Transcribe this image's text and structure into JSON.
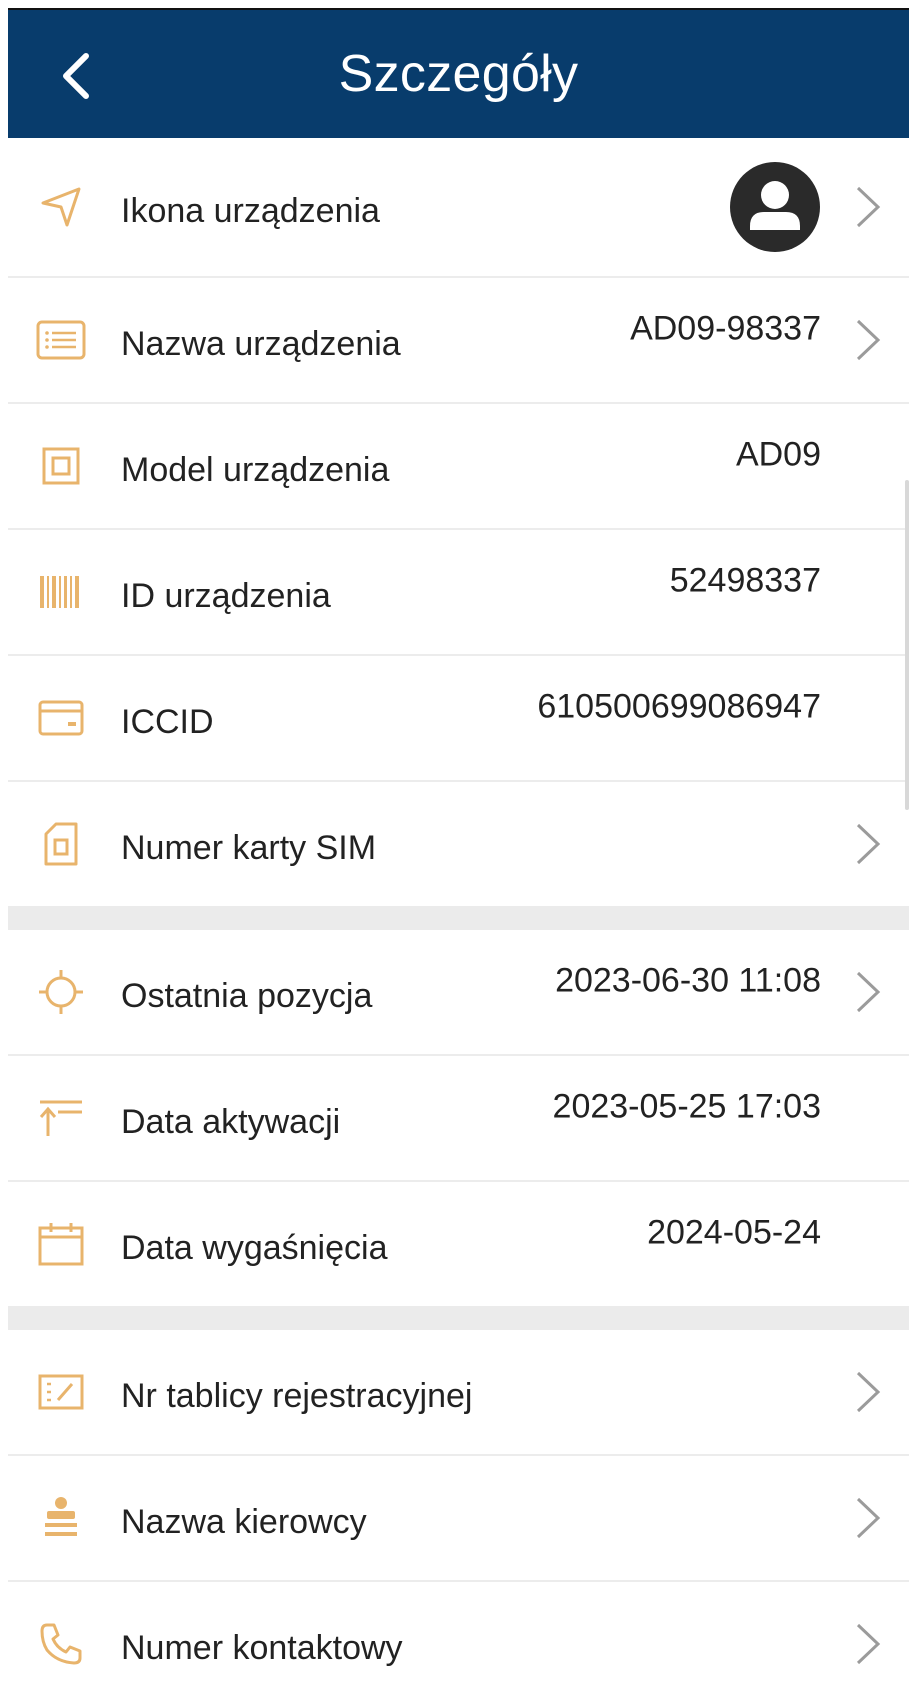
{
  "header": {
    "title": "Szczegóły",
    "background": "#083c6c"
  },
  "accent_color": "#e8b46c",
  "rows": [
    {
      "label": "Ikona urządzenia",
      "value": "",
      "icon": "navigation-arrow-icon",
      "chevron": true,
      "avatar": true
    },
    {
      "label": "Nazwa urządzenia",
      "value": "AD09-98337",
      "icon": "list-icon",
      "chevron": true
    },
    {
      "label": "Model urządzenia",
      "value": "AD09",
      "icon": "model-square-icon",
      "chevron": false
    },
    {
      "label": "ID urządzenia",
      "value": "52498337",
      "icon": "barcode-icon",
      "chevron": false
    },
    {
      "label": "ICCID",
      "value": "610500699086947",
      "icon": "card-icon",
      "chevron": false
    },
    {
      "label": "Numer karty SIM",
      "value": "",
      "icon": "sim-card-icon",
      "chevron": true
    },
    {
      "label": "Ostatnia pozycja",
      "value": "2023-06-30 11:08",
      "icon": "crosshair-icon",
      "chevron": true
    },
    {
      "label": "Data aktywacji",
      "value": "2023-05-25 17:03",
      "icon": "activation-arrow-icon",
      "chevron": false
    },
    {
      "label": "Data wygaśnięcia",
      "value": "2024-05-24",
      "icon": "calendar-icon",
      "chevron": false
    },
    {
      "label": "Nr tablicy rejestracyjnej",
      "value": "",
      "icon": "license-plate-icon",
      "chevron": true
    },
    {
      "label": "Nazwa kierowcy",
      "value": "",
      "icon": "driver-icon",
      "chevron": true
    },
    {
      "label": "Numer kontaktowy",
      "value": "",
      "icon": "phone-icon",
      "chevron": true
    }
  ]
}
